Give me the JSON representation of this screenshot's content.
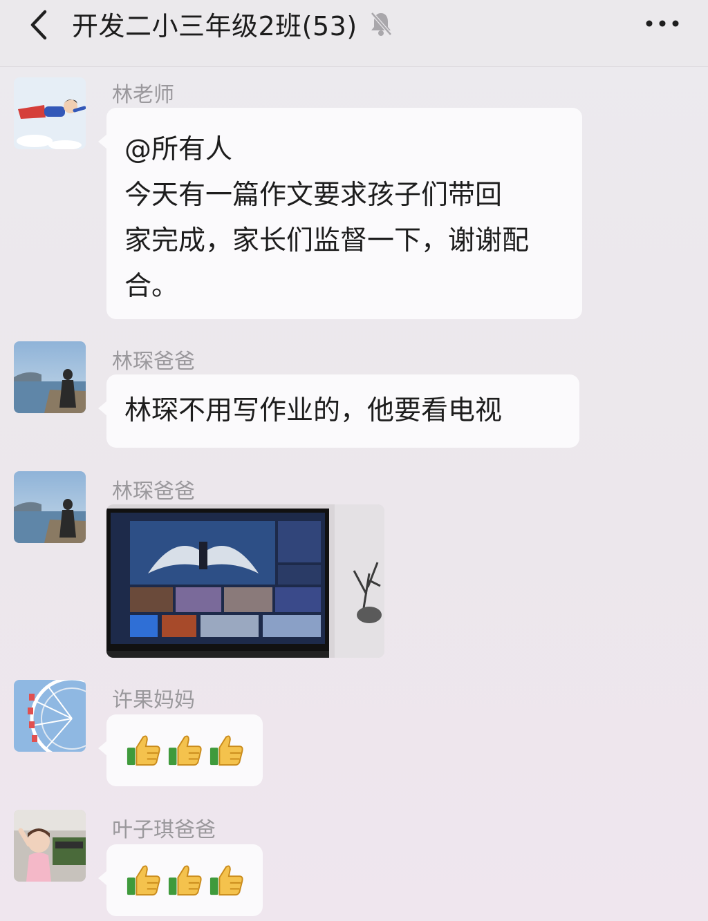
{
  "header": {
    "title": "开发二小三年级2班(53)",
    "back_icon": "chevron-left-icon",
    "mute_icon": "bell-off-icon",
    "more_icon": "more-dots-icon"
  },
  "messages": [
    {
      "sender": "林老师",
      "lines": [
        "@所有人",
        "今天有一篇作文要求孩子们带回",
        "家完成，家长们监督一下，谢谢配",
        "合。"
      ]
    },
    {
      "sender": "林琛爸爸",
      "lines": [
        "林琛不用写作业的，他要看电视"
      ]
    },
    {
      "sender": "林琛爸爸",
      "image": "tv-photo"
    },
    {
      "sender": "许果妈妈",
      "emoji": "thumbs-up-icon",
      "emoji_count": 3
    },
    {
      "sender": "叶子琪爸爸",
      "emoji": "thumbs-up-icon",
      "emoji_count": 3
    }
  ],
  "colors": {
    "background": "#ece8ee",
    "bubble": "#fbfafc",
    "sender_name": "#9a989c",
    "text": "#1d1d1d"
  }
}
